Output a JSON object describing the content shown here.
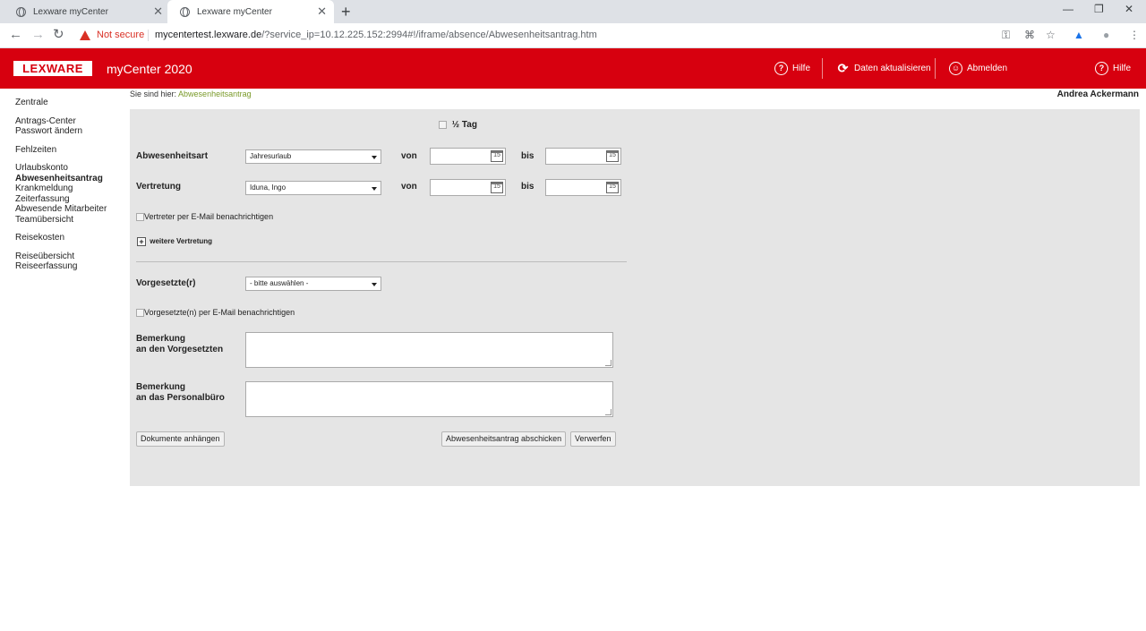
{
  "browser": {
    "tabs": [
      {
        "title": "Lexware myCenter",
        "active": false
      },
      {
        "title": "Lexware myCenter",
        "active": true
      }
    ],
    "security_label": "Not secure",
    "url_host": "mycentertest.lexware.de",
    "url_path": "/?service_ip=10.12.225.152:2994#!/iframe/absence/Abwesenheitsantrag.htm"
  },
  "header": {
    "logo": "LEXWARE",
    "title": "myCenter 2020",
    "buttons": {
      "help1": "Hilfe",
      "refresh": "Daten aktualisieren",
      "logout": "Abmelden",
      "help2": "Hilfe"
    }
  },
  "sidebar": {
    "items": [
      "Zentrale",
      "Antrags-Center",
      "Passwort ändern",
      "Fehlzeiten",
      "Urlaubskonto",
      "Abwesenheitsantrag",
      "Krankmeldung",
      "Zeiterfassung",
      "Abwesende Mitarbeiter",
      "Teamübersicht",
      "Reisekosten",
      "Reiseübersicht",
      "Reiseerfassung"
    ]
  },
  "breadcrumb": {
    "prefix": "Sie sind hier:",
    "current": "Abwesenheitsantrag"
  },
  "user": "Andrea Ackermann",
  "form": {
    "half_day": "½ Tag",
    "absence_type_label": "Abwesenheitsart",
    "absence_type_value": "Jahresurlaub",
    "substitute_label": "Vertretung",
    "substitute_value": "Iduna, Ingo",
    "from_label": "von",
    "to_label": "bis",
    "calendar_day": "15",
    "notify_substitute": "Vertreter per E-Mail benachrichtigen",
    "more_substitute": "weitere Vertretung",
    "supervisor_label": "Vorgesetzte(r)",
    "supervisor_value": "- bitte auswählen -",
    "notify_supervisor": "Vorgesetzte(n) per E-Mail benachrichtigen",
    "remark_supervisor_line1": "Bemerkung",
    "remark_supervisor_line2": "an den Vorgesetzten",
    "remark_office_line1": "Bemerkung",
    "remark_office_line2": "an das Personalbüro",
    "attach_button": "Dokumente anhängen",
    "submit_button": "Abwesenheitsantrag abschicken",
    "discard_button": "Verwerfen"
  }
}
